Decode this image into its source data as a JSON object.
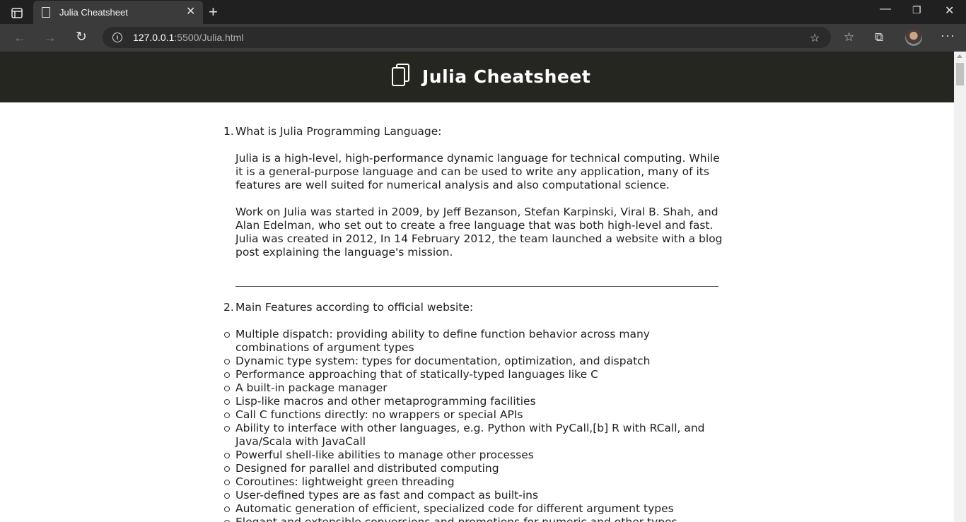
{
  "browser": {
    "tab_title": "Julia Cheatsheet",
    "url_host": "127.0.0.1",
    "url_rest": ":5500/Julia.html"
  },
  "header": {
    "title": "Julia Cheatsheet"
  },
  "sections": [
    {
      "number": "1.",
      "heading": "What is Julia Programming Language:",
      "paragraphs": [
        "Julia is a high-level, high-performance dynamic language for technical computing. While it is a general-purpose language and can be used to write any application, many of its features are well suited for numerical analysis and also computational science.",
        "Work on Julia was started in 2009, by Jeff Bezanson, Stefan Karpinski, Viral B. Shah, and Alan Edelman, who set out to create a free language that was both high-level and fast. Julia was created in 2012, In 14 February 2012, the team launched a website with a blog post explaining the language's mission."
      ]
    },
    {
      "number": "2.",
      "heading": "Main Features according to official website:",
      "items": [
        "Multiple dispatch: providing ability to define function behavior across many combinations of argument types",
        "Dynamic type system: types for documentation, optimization, and dispatch",
        "Performance approaching that of statically-typed languages like C",
        "A built-in package manager",
        "Lisp-like macros and other metaprogramming facilities",
        "Call C functions directly: no wrappers or special APIs",
        "Ability to interface with other languages, e.g. Python with PyCall,[b] R with RCall, and Java/Scala with JavaCall",
        "Powerful shell-like abilities to manage other processes",
        "Designed for parallel and distributed computing",
        "Coroutines: lightweight green threading",
        "User-defined types are as fast and compact as built-ins",
        "Automatic generation of efficient, specialized code for different argument types",
        "Elegant and extensible conversions and promotions for numeric and other types"
      ]
    }
  ]
}
